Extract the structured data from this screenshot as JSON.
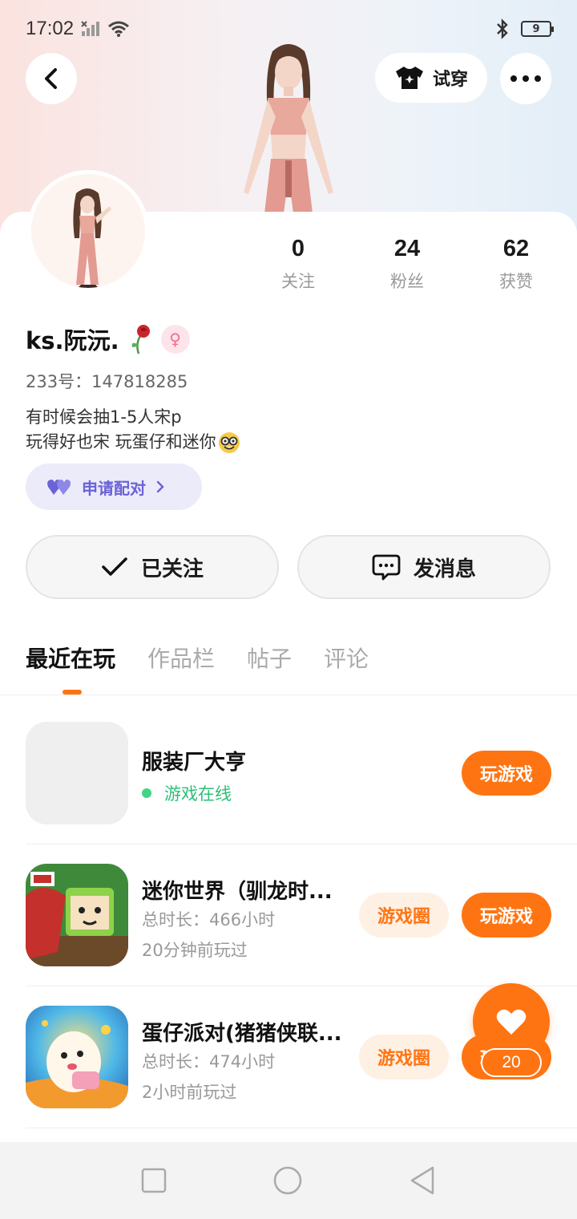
{
  "status_bar": {
    "time": "17:02",
    "battery": "9"
  },
  "header": {
    "tryon_label": "试穿"
  },
  "profile": {
    "stats": [
      {
        "value": "0",
        "label": "关注"
      },
      {
        "value": "24",
        "label": "粉丝"
      },
      {
        "value": "62",
        "label": "获赞"
      }
    ],
    "username": "ks.阮沅.",
    "gender_symbol": "♀",
    "uid": "233号：147818285",
    "bio_line1": "有时候会抽1-5人宋p",
    "bio_line2": "玩得好也宋 玩蛋仔和迷你",
    "pair_label": "申请配对"
  },
  "actions": {
    "follow_label": "已关注",
    "message_label": "发消息"
  },
  "tabs": [
    "最近在玩",
    "作品栏",
    "帖子",
    "评论"
  ],
  "games": [
    {
      "title": "服装厂大亨",
      "status": "游戏在线",
      "play_label": "玩游戏"
    },
    {
      "title": "迷你世界（驯龙时...",
      "duration": "总时长：466小时",
      "last_played": "20分钟前玩过",
      "circle_label": "游戏圈",
      "play_label": "玩游戏"
    },
    {
      "title": "蛋仔派对(猪猪侠联...",
      "duration": "总时长：474小时",
      "last_played": "2小时前玩过",
      "circle_label": "游戏圈",
      "play_label": "玩游戏"
    }
  ],
  "like_count": "20",
  "colors": {
    "accent": "#ff7412",
    "pair_accent": "#6a63d6",
    "online": "#2cbf76"
  }
}
